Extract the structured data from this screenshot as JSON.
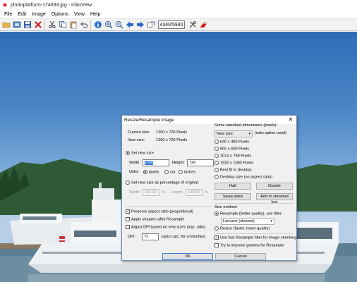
{
  "window": {
    "title": "photoplatform-174833.jpg - IrfanView"
  },
  "menu": [
    "File",
    "Edit",
    "Image",
    "Options",
    "View",
    "Help"
  ],
  "toolbar": {
    "counter": "4340/5930"
  },
  "dialog": {
    "title": "Resize/Resample image",
    "close": "✕",
    "current_size_label": "Current size:",
    "current_size_value": "1200  x  726  Pixels",
    "new_size_label": "New size:",
    "new_size_value": "1200  x  726  Pixels",
    "set_new_size": "Set new size:",
    "width_label": "Width:",
    "width_value": "1200",
    "height_label": "Height:",
    "height_value": "726",
    "units_label": "Units:",
    "unit_pixels": "pixels",
    "unit_cm": "cm",
    "unit_inches": "inches",
    "set_percent": "Set new size as percentage of original:",
    "pct_width_label": "Width:",
    "pct_width_value": "100.00",
    "pct_height_label": "Height:",
    "pct_height_value": "100.00",
    "pct_sign": "%",
    "preserve_aspect": "Preserve aspect ratio (proportional)",
    "apply_sharpen": "Apply sharpen after Resample",
    "adjust_dpi": "Adjust DPI based on new sizes (asp. ratio)",
    "dpi_label": "DPI:",
    "dpi_value": "72",
    "dpi_note": "(auto calc. for cm/inches)",
    "standard_dims": "Some standard dimensions (pixels):",
    "new_size_combo": "New size:",
    "ratio_note": "(ratio option used)",
    "dims": [
      "640 x 480 Pixels",
      "800 x 600 Pixels",
      "1024 x 768 Pixels",
      "1920 x 1080 Pixels",
      "Best fit to desktop",
      "Desktop size (no aspect ratio)"
    ],
    "half": "Half",
    "double": "Double",
    "swap_sides": "Swap sides",
    "add_standard": "Add to standard box",
    "size_method": "Size method:",
    "resample": "Resample (better quality), use filter:",
    "filter": "Lanczos (slowest)",
    "resize": "Resize (faster, lower quality)",
    "fast_resample": "Use fast Resample filter for image shrinking",
    "gamma": "Try to improve gamma for Resample",
    "ok": "OK",
    "cancel": "Cancel"
  }
}
